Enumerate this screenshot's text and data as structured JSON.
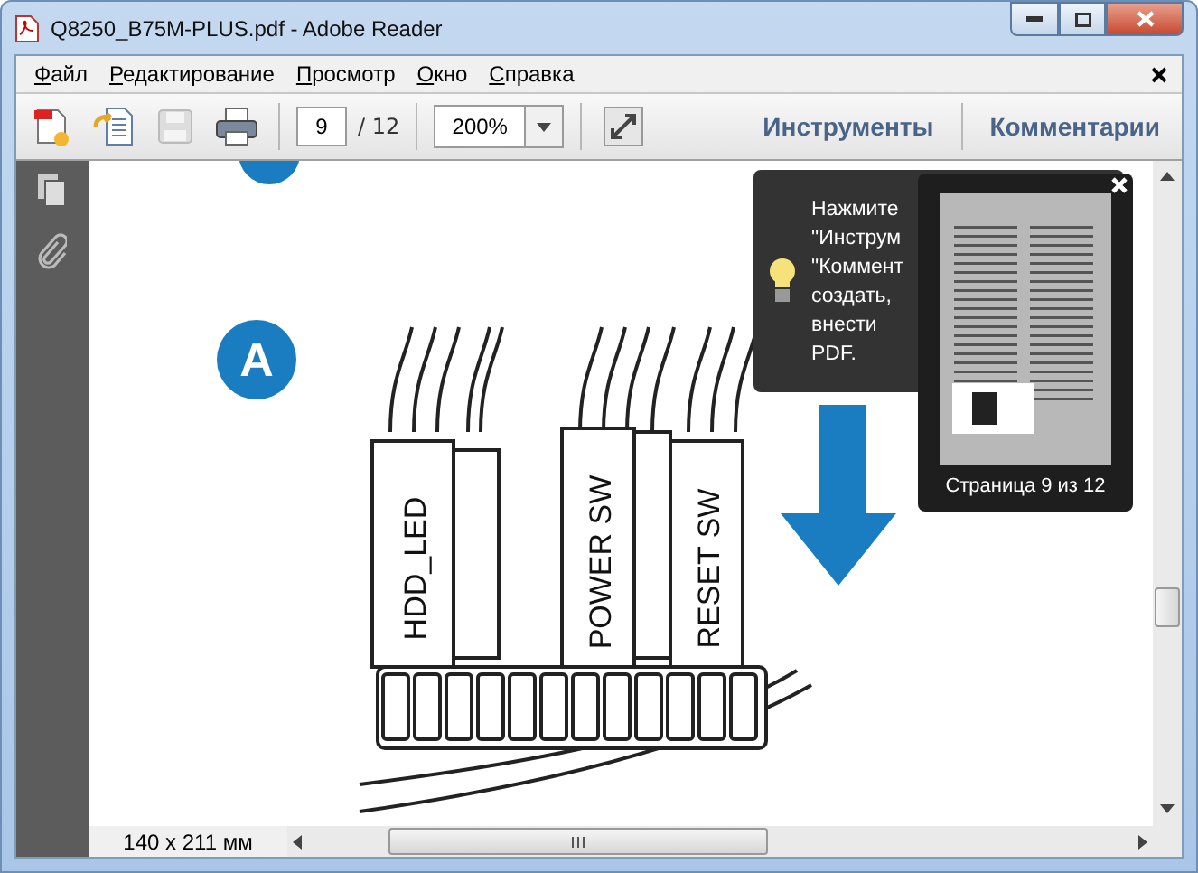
{
  "window": {
    "title": "Q8250_B75M-PLUS.pdf - Adobe Reader"
  },
  "menu": [
    "Файл",
    "Редактирование",
    "Просмотр",
    "Окно",
    "Справка"
  ],
  "toolbar": {
    "page": "9",
    "page_total": "/ 12",
    "zoom": "200%",
    "tools": "Инструменты",
    "comments": "Комментарии"
  },
  "document": {
    "step_badge": "A",
    "connector_labels": [
      "HDD_LED",
      "POWER SW",
      "RESET SW"
    ]
  },
  "tooltip": {
    "lines": [
      "Нажмите",
      "\"Инструм",
      "\"Коммент",
      "создать,",
      "внести",
      "PDF."
    ]
  },
  "thumbnail_popup": {
    "label": "Страница 9 из 12"
  },
  "status": {
    "page_size": "140 x 211 мм"
  }
}
